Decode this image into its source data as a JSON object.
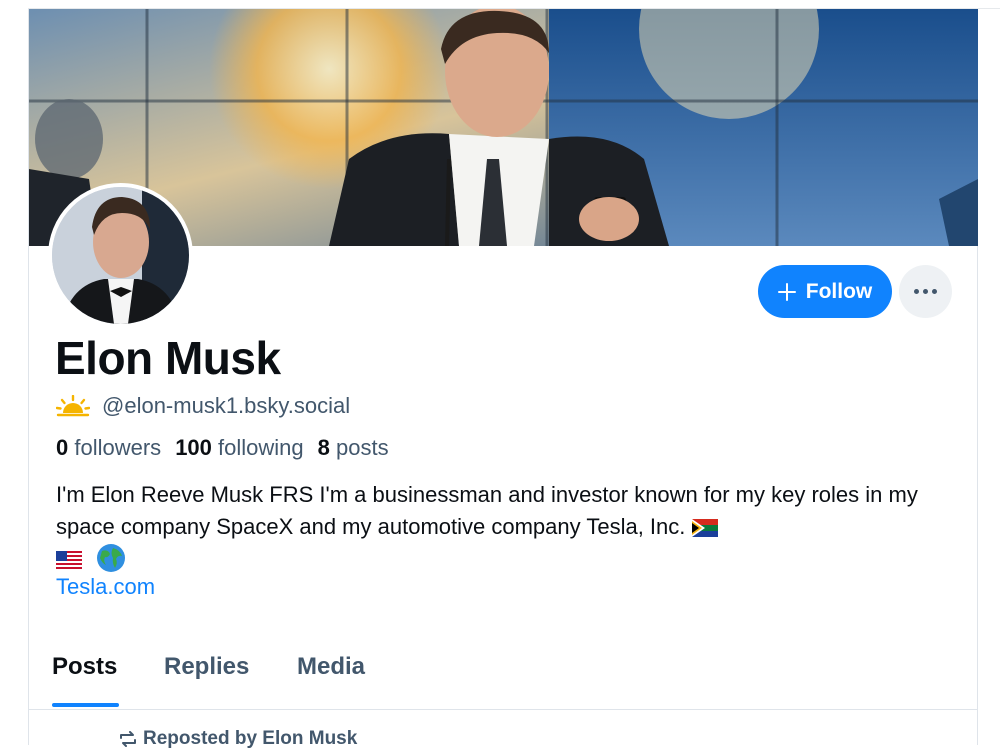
{
  "profile": {
    "display_name": "Elon Musk",
    "handle": "@elon-musk1.bsky.social",
    "handle_icon": "sun-cloud-icon",
    "followers_count": "0",
    "followers_label": "followers",
    "following_count": "100",
    "following_label": "following",
    "posts_count": "8",
    "posts_label": "posts",
    "bio": "I'm Elon Reeve Musk FRS I'm a businessman and investor known for my key roles in my space company SpaceX and my automotive company Tesla, Inc.",
    "bio_emojis": [
      "south-africa-flag",
      "us-flag",
      "globe-icon"
    ],
    "link": "Tesla.com"
  },
  "actions": {
    "follow_label": "Follow",
    "more_icon": "ellipsis-icon"
  },
  "tabs": [
    {
      "label": "Posts",
      "active": true
    },
    {
      "label": "Replies",
      "active": false
    },
    {
      "label": "Media",
      "active": false
    }
  ],
  "feed": {
    "repost_label": "Reposted by Elon Musk"
  },
  "colors": {
    "accent": "#1083fe",
    "text_primary": "#0b0f14",
    "text_secondary": "#42576c"
  }
}
